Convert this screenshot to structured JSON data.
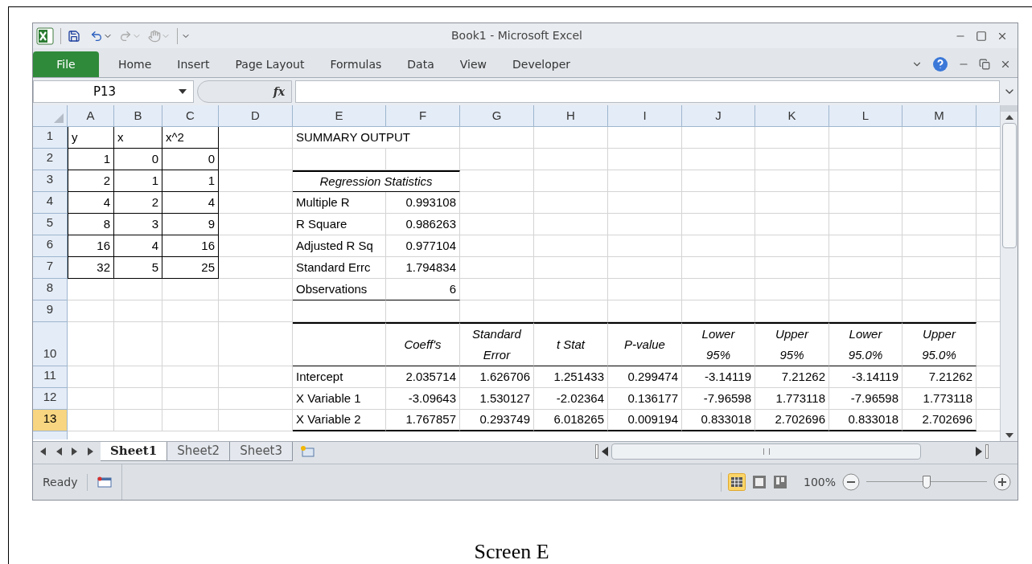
{
  "window": {
    "title": "Book1  -  Microsoft Excel"
  },
  "ribbon_tabs": [
    {
      "label": "File",
      "selected": true
    },
    {
      "label": "Home",
      "selected": false
    },
    {
      "label": "Insert",
      "selected": false
    },
    {
      "label": "Page Layout",
      "selected": false
    },
    {
      "label": "Formulas",
      "selected": false
    },
    {
      "label": "Data",
      "selected": false
    },
    {
      "label": "View",
      "selected": false
    },
    {
      "label": "Developer",
      "selected": false
    }
  ],
  "formula_bar": {
    "name_box": "P13",
    "fx_label": "fx"
  },
  "grid": {
    "columns": [
      "A",
      "B",
      "C",
      "D",
      "E",
      "F",
      "G",
      "H",
      "I",
      "J",
      "K",
      "L",
      "M"
    ],
    "rows": [
      {
        "number": "1",
        "selected": false,
        "kind": "labels",
        "cells": {
          "a": "y",
          "b": "x",
          "c": "x^2",
          "e": "SUMMARY OUTPUT"
        }
      },
      {
        "number": "2",
        "selected": false,
        "kind": "data",
        "cells": {
          "a": "1",
          "b": "0",
          "c": "0"
        }
      },
      {
        "number": "3",
        "selected": false,
        "kind": "stats-heading",
        "cells": {
          "a": "2",
          "b": "1",
          "c": "1",
          "e": "Regression Statistics"
        }
      },
      {
        "number": "4",
        "selected": false,
        "kind": "stats",
        "cells": {
          "a": "4",
          "b": "2",
          "c": "4",
          "e": "Multiple R",
          "f": "0.993108"
        }
      },
      {
        "number": "5",
        "selected": false,
        "kind": "stats",
        "cells": {
          "a": "8",
          "b": "3",
          "c": "9",
          "e": "R Square",
          "f": "0.986263"
        }
      },
      {
        "number": "6",
        "selected": false,
        "kind": "stats",
        "cells": {
          "a": "16",
          "b": "4",
          "c": "16",
          "e": "Adjusted R Sq",
          "f": "0.977104"
        }
      },
      {
        "number": "7",
        "selected": false,
        "kind": "stats",
        "cells": {
          "a": "32",
          "b": "5",
          "c": "25",
          "e": "Standard Errc",
          "f": "1.794834"
        }
      },
      {
        "number": "8",
        "selected": false,
        "kind": "stats-last",
        "cells": {
          "e": "Observations",
          "f": "6"
        }
      },
      {
        "number": "9",
        "selected": false,
        "kind": "plain",
        "cells": {}
      },
      {
        "number": "10",
        "selected": false,
        "kind": "table-heading",
        "cells": {
          "f": "Coeff's",
          "g": "Standard\nError",
          "h": "t Stat",
          "i": "P-value",
          "j": "Lower\n95%",
          "k": "Upper\n95%",
          "l": "Lower\n95.0%",
          "m": "Upper\n95.0%"
        }
      },
      {
        "number": "11",
        "selected": false,
        "kind": "table",
        "cells": {
          "e": "Intercept",
          "f": "2.035714",
          "g": "1.626706",
          "h": "1.251433",
          "i": "0.299474",
          "j": "-3.14119",
          "k": "7.21262",
          "l": "-3.14119",
          "m": "7.21262"
        }
      },
      {
        "number": "12",
        "selected": false,
        "kind": "table",
        "cells": {
          "e": "X Variable 1",
          "f": "-3.09643",
          "g": "1.530127",
          "h": "-2.02364",
          "i": "0.136177",
          "j": "-7.96598",
          "k": "1.773118",
          "l": "-7.96598",
          "m": "1.773118"
        }
      },
      {
        "number": "13",
        "selected": true,
        "kind": "table-last",
        "cells": {
          "e": "X Variable 2",
          "f": "1.767857",
          "g": "0.293749",
          "h": "6.018265",
          "i": "0.009194",
          "j": "0.833018",
          "k": "2.702696",
          "l": "0.833018",
          "m": "2.702696"
        }
      }
    ]
  },
  "sheet_tabs": [
    {
      "label": "Sheet1",
      "selected": true
    },
    {
      "label": "Sheet2",
      "selected": false
    },
    {
      "label": "Sheet3",
      "selected": false
    }
  ],
  "status_bar": {
    "status": "Ready",
    "zoom": "100%",
    "zoom_slider": {
      "level": 0.5
    }
  },
  "caption": "Screen E"
}
